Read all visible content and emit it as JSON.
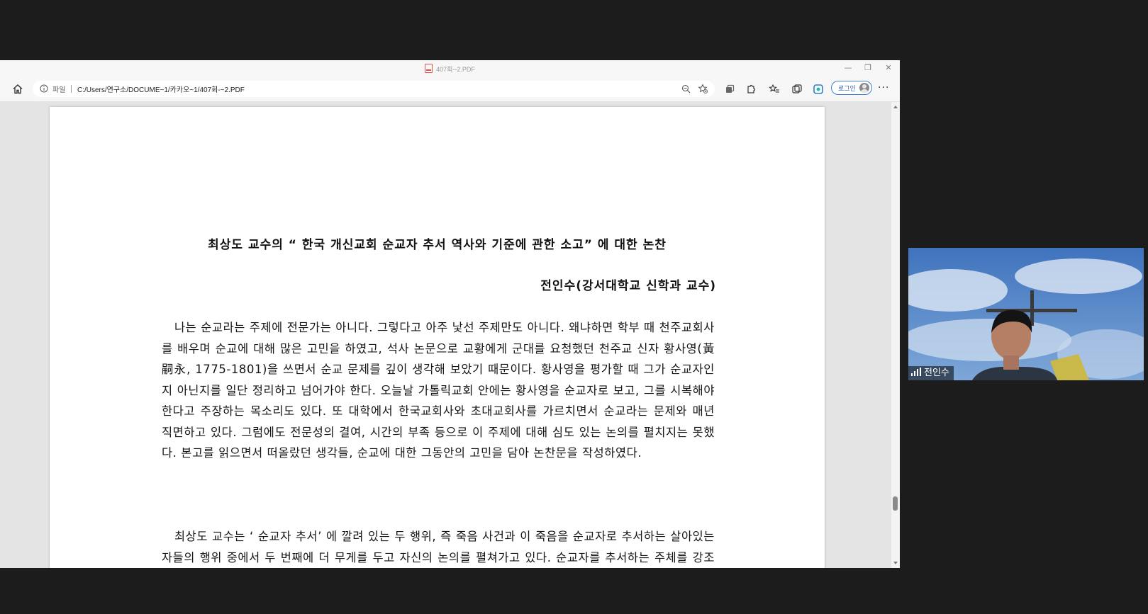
{
  "window": {
    "title": "407회--2.PDF",
    "controls": {
      "minimize": "—",
      "restore": "❐",
      "close": "✕"
    }
  },
  "toolbar": {
    "scheme_label": "파일",
    "url": "C:/Users/연구소/DOCUME~1/카카오~1/407회-~2.PDF",
    "login_label": "로그인",
    "more_label": "···"
  },
  "document": {
    "title": "최상도 교수의 “ 한국 개신교회 순교자 추서 역사와 기준에 관한 소고” 에 대한 논찬",
    "author": "전인수(강서대학교 신학과 교수)",
    "paragraphs": [
      "나는 순교라는 주제에 전문가는 아니다. 그렇다고 아주 낯선 주제만도 아니다. 왜냐하면 학부 때 천주교회사를 배우며 순교에 대해 많은 고민을 하였고, 석사 논문으로 교황에게 군대를 요청했던 천주교 신자 황사영(黃嗣永, 1775-1801)을 쓰면서 순교 문제를 깊이 생각해 보았기 때문이다. 황사영을 평가할 때 그가 순교자인지 아닌지를 일단 정리하고 넘어가야 한다. 오늘날 가톨릭교회 안에는 황사영을 순교자로 보고, 그를 시복해야 한다고 주장하는 목소리도 있다. 또 대학에서 한국교회사와 초대교회사를 가르치면서 순교라는 문제와 매년 직면하고 있다. 그럼에도 전문성의 결여, 시간의 부족 등으로 이 주제에 대해 심도 있는 논의를 펼치지는 못했다. 본고를 읽으면서 떠올랐던 생각들, 순교에 대한 그동안의 고민을 담아 논찬문을 작성하였다.",
      "최상도 교수는 ‘ 순교자 추서’ 에 깔려 있는 두 행위, 즉 죽음 사건과 이 죽음을 순교자로 추서하는 살아있는 자들의 행위 중에서 두 번째에 더 무게를 두고 자신의 논의를 펼쳐가고 있다. 순교자를 추서하는 주체를 강조하면서 그가 보여주고자 하는 것은 순교자 추서 역사와 기준에 관한 문제이다."
    ]
  },
  "video": {
    "participant_name": "전인수"
  },
  "colors": {
    "accent": "#3f7fd0",
    "background": "#1c1c1c"
  }
}
